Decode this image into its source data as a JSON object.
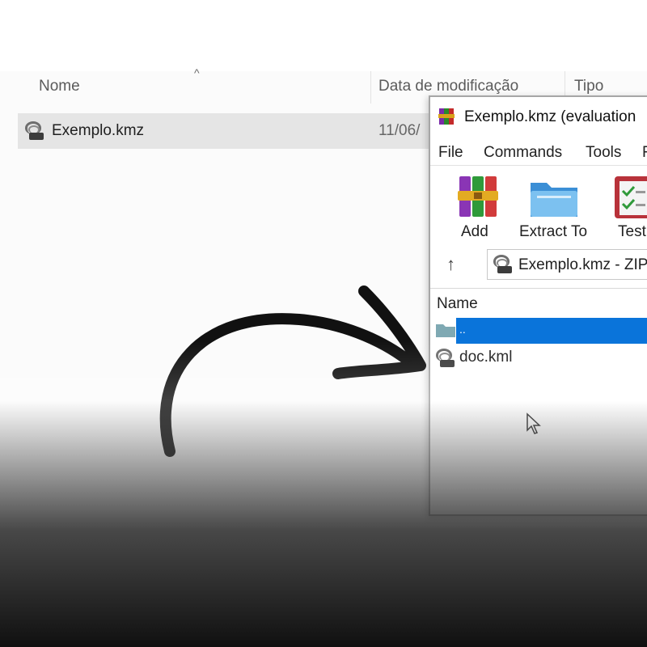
{
  "explorer": {
    "columns": [
      {
        "label": "Nome"
      },
      {
        "label": "Data de modificação"
      },
      {
        "label": "Tipo"
      }
    ],
    "file": {
      "name": "Exemplo.kmz",
      "date": "11/06/"
    }
  },
  "winrar": {
    "title": "Exemplo.kmz (evaluation",
    "menu": [
      "File",
      "Commands",
      "Tools",
      "F"
    ],
    "toolbar": [
      "Add",
      "Extract To",
      "Test"
    ],
    "path": "Exemplo.kmz - ZIP",
    "list_header": "Name",
    "items": [
      {
        "name": "..",
        "type": "parent-folder",
        "selected": true
      },
      {
        "name": "doc.kml",
        "type": "kml-file",
        "selected": false
      }
    ]
  },
  "icons": [
    "sort-chevron-icon",
    "kmz-file-icon",
    "winrar-icon",
    "add-archive-icon",
    "extract-folder-icon",
    "test-clipboard-icon",
    "up-arrow-icon",
    "folder-icon",
    "mouse-cursor-icon",
    "curved-arrow-icon"
  ],
  "colors": {
    "selection": "#0a74da",
    "explorer_row": "#e5e5e5",
    "folder": "#7fa9b3"
  }
}
